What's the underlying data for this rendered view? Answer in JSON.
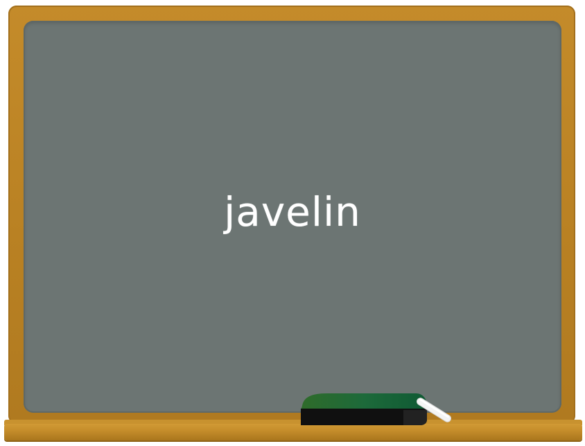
{
  "board": {
    "word": "javelin"
  },
  "colors": {
    "frame": "#b98123",
    "board": "#6c7573",
    "chalk_text": "#ffffff",
    "eraser_top": "#1f6b3a",
    "eraser_base": "#111111"
  },
  "props": {
    "eraser_icon": "chalkboard-eraser-icon",
    "chalk_icon": "chalk-stick-icon"
  }
}
